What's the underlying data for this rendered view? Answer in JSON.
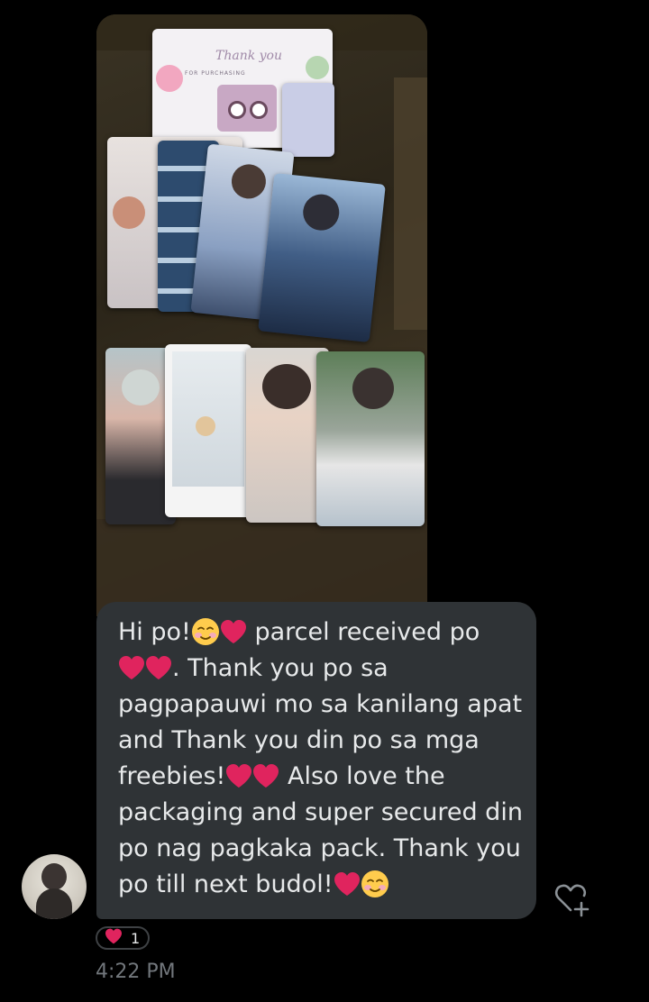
{
  "message": {
    "lines": [
      [
        "Hi po!",
        "smile",
        "heart",
        " parcel received po"
      ],
      [
        "heart",
        "heart",
        ". Thank you po sa"
      ],
      [
        "pagpapauwi mo sa kanilang apat"
      ],
      [
        "and Thank you din po sa mga"
      ],
      [
        "freebies!",
        "heart",
        "heart",
        " Also love the"
      ],
      [
        "packaging and super secured din"
      ],
      [
        "po nag pagkaka pack. Thank you"
      ],
      [
        "po till next budol!",
        "heart",
        "smile"
      ]
    ]
  },
  "photo": {
    "thank_you_card": {
      "script": "Thank you",
      "subtitle": "FOR PURCHASING"
    }
  },
  "reaction": {
    "emoji": "heart",
    "count": "1"
  },
  "timestamp": "4:22 PM",
  "colors": {
    "bubble": "#2f3336",
    "background": "#000000",
    "heart": "#e0245e",
    "muted": "#71767b",
    "text": "#e7e9ea"
  }
}
